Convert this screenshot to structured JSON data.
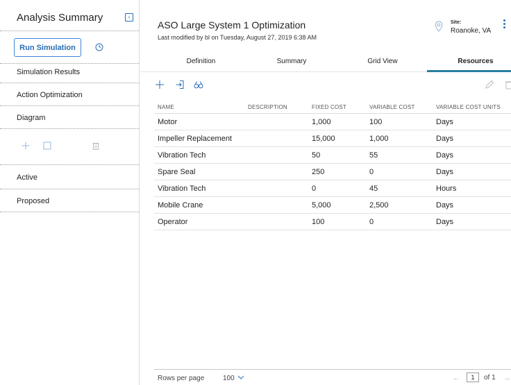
{
  "sidebar": {
    "title": "Analysis Summary",
    "run_button": "Run Simulation",
    "items": [
      {
        "label": "Simulation Results"
      },
      {
        "label": "Action Optimization"
      },
      {
        "label": "Diagram"
      }
    ],
    "status_items": [
      {
        "label": "Active"
      },
      {
        "label": "Proposed"
      }
    ]
  },
  "header": {
    "title": "ASO Large System 1 Optimization",
    "subtitle": "Last modified by bl on Tuesday, August 27, 2019 6:38 AM",
    "site_label": "Site:",
    "site_value": "Roanoke, VA"
  },
  "tabs": [
    {
      "label": "Definition"
    },
    {
      "label": "Summary"
    },
    {
      "label": "Grid View"
    },
    {
      "label": "Resources"
    }
  ],
  "active_tab": "Resources",
  "grid": {
    "columns": [
      "NAME",
      "DESCRIPTION",
      "FIXED COST",
      "VARIABLE COST",
      "VARIABLE COST UNITS"
    ],
    "rows": [
      [
        "Motor",
        "",
        "1,000",
        "100",
        "Days"
      ],
      [
        "Impeller Replacement",
        "",
        "15,000",
        "1,000",
        "Days"
      ],
      [
        "Vibration Tech",
        "",
        "50",
        "55",
        "Days"
      ],
      [
        "Spare Seal",
        "",
        "250",
        "0",
        "Days"
      ],
      [
        "Vibration Tech",
        "",
        "0",
        "45",
        "Hours"
      ],
      [
        "Mobile Crane",
        "",
        "5,000",
        "2,500",
        "Days"
      ],
      [
        "Operator",
        "",
        "100",
        "0",
        "Days"
      ]
    ]
  },
  "footer": {
    "rows_label": "Rows per page",
    "rows_value": "100",
    "page_current": "1",
    "page_of": "of 1"
  },
  "colors": {
    "accent": "#2a6db5",
    "tab_underline": "#2b7ea1"
  }
}
